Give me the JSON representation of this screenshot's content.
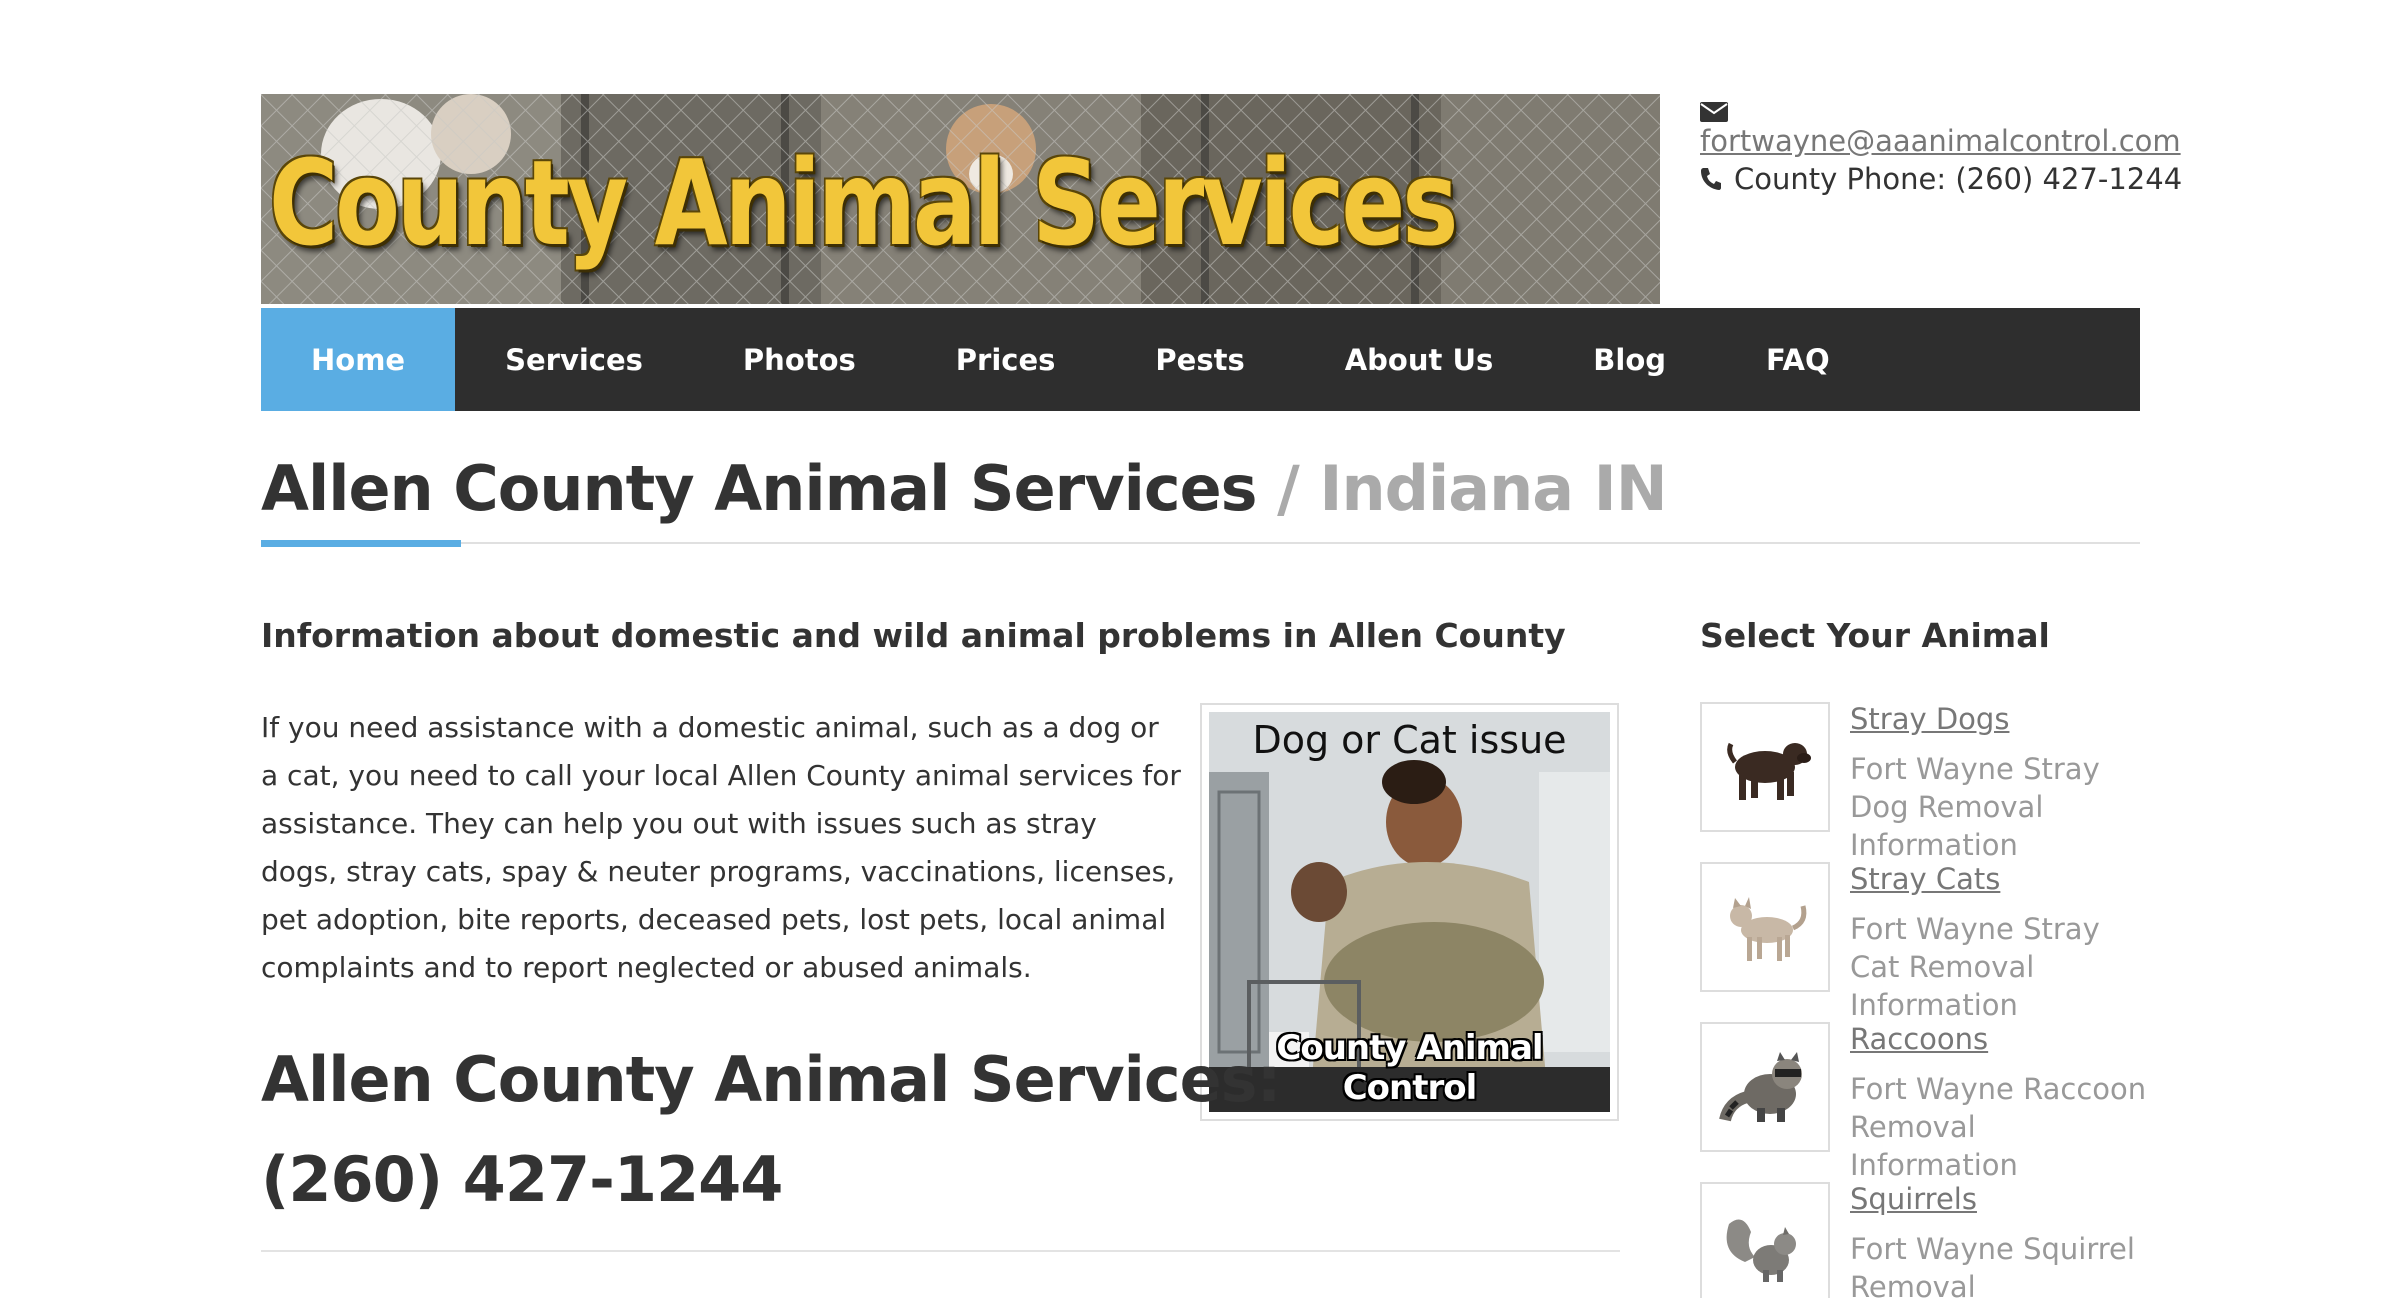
{
  "header": {
    "banner_title": "County Animal Services",
    "email": "fortwayne@aaanimalcontrol.com",
    "phone_text": "County Phone: (260) 427-1244",
    "email_icon": "envelope-icon",
    "phone_icon": "phone-icon"
  },
  "nav": {
    "items": [
      {
        "label": "Home",
        "active": true
      },
      {
        "label": "Services",
        "active": false
      },
      {
        "label": "Photos",
        "active": false
      },
      {
        "label": "Prices",
        "active": false
      },
      {
        "label": "Pests",
        "active": false
      },
      {
        "label": "About Us",
        "active": false
      },
      {
        "label": "Blog",
        "active": false
      },
      {
        "label": "FAQ",
        "active": false
      }
    ]
  },
  "page": {
    "title_main": "Allen County Animal Services",
    "title_sub": " / Indiana IN"
  },
  "main": {
    "heading": "Information about domestic and wild animal problems in Allen County",
    "paragraph": "If you need assistance with a domestic animal, such as a dog or a cat, you need to call your local Allen County animal services for assistance. They can help you out with issues such as stray dogs, stray cats, spay & neuter programs, vaccinations, licenses, pet adoption, bite reports, deceased pets, lost pets, local animal complaints and to report neglected or abused animals.",
    "figure_top_text": "Dog or Cat issue",
    "figure_bottom_text": "County Animal Control",
    "callout_line1": "Allen County Animal Services:",
    "callout_line2": "(260) 427-1244"
  },
  "sidebar": {
    "heading": "Select Your Animal",
    "animals": [
      {
        "name": "Stray Dogs",
        "desc": "Fort Wayne Stray Dog Removal Information",
        "icon": "dog-icon"
      },
      {
        "name": "Stray Cats",
        "desc": "Fort Wayne Stray Cat Removal Information",
        "icon": "cat-icon"
      },
      {
        "name": "Raccoons",
        "desc": "Fort Wayne Raccoon Removal Information",
        "icon": "raccoon-icon"
      },
      {
        "name": "Squirrels",
        "desc": "Fort Wayne Squirrel Removal Information",
        "icon": "squirrel-icon"
      }
    ]
  },
  "colors": {
    "nav_bg": "#2e2e2e",
    "accent": "#5aade3",
    "banner_text": "#f2c63a",
    "muted_text": "#999999"
  }
}
